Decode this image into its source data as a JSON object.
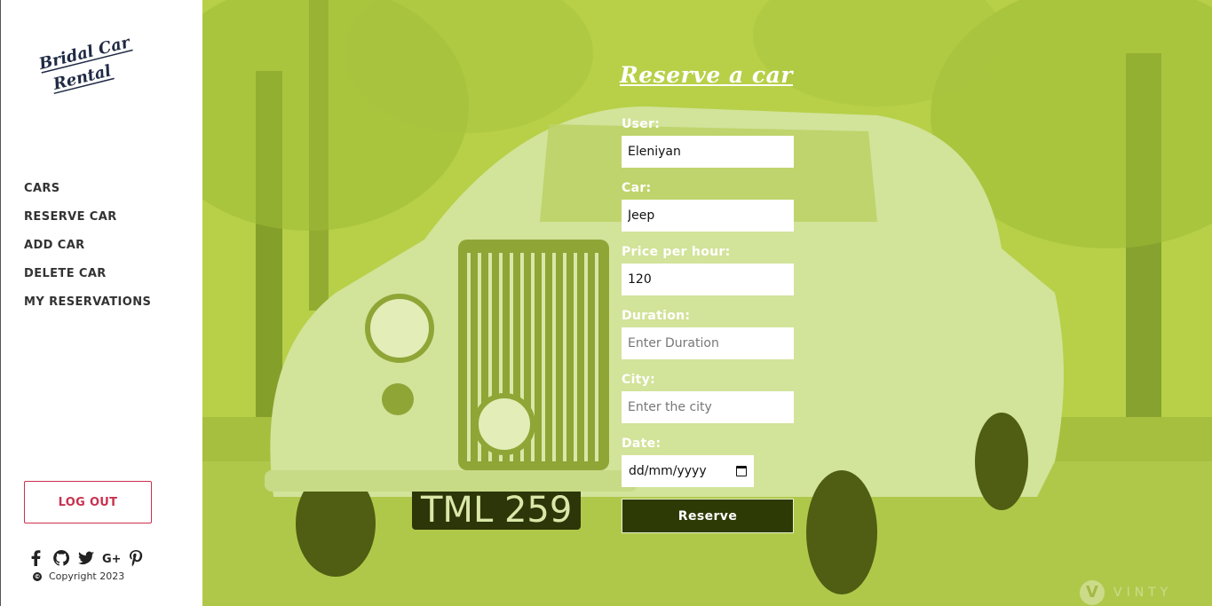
{
  "brand": {
    "logo_text": "Bridal Car Rental",
    "dark_color": "#1f2a44",
    "accent": "#c9324f"
  },
  "nav": {
    "items": [
      {
        "label": "CARS"
      },
      {
        "label": "RESERVE CAR"
      },
      {
        "label": "ADD CAR"
      },
      {
        "label": "DELETE CAR"
      },
      {
        "label": "MY RESERVATIONS"
      }
    ]
  },
  "logout_label": "LOG OUT",
  "socials": [
    "facebook-icon",
    "github-icon",
    "twitter-icon",
    "google-plus-icon",
    "pinterest-icon"
  ],
  "copyright": "Copyright 2023",
  "form": {
    "title": "Reserve a car",
    "user_label": "User:",
    "user_value": "Eleniyan",
    "car_label": "Car:",
    "car_value": "Jeep",
    "price_label": "Price per hour:",
    "price_value": "120",
    "duration_label": "Duration:",
    "duration_placeholder": "Enter Duration",
    "city_label": "City:",
    "city_placeholder": "Enter the city",
    "date_label": "Date:",
    "date_placeholder": "dd/mm/yyyy",
    "submit_label": "Reserve"
  },
  "hero": {
    "overlay_color": "#b5cf4a",
    "plate_text": "TML 259"
  },
  "watermark": {
    "letter": "V",
    "text": "VINTY"
  }
}
